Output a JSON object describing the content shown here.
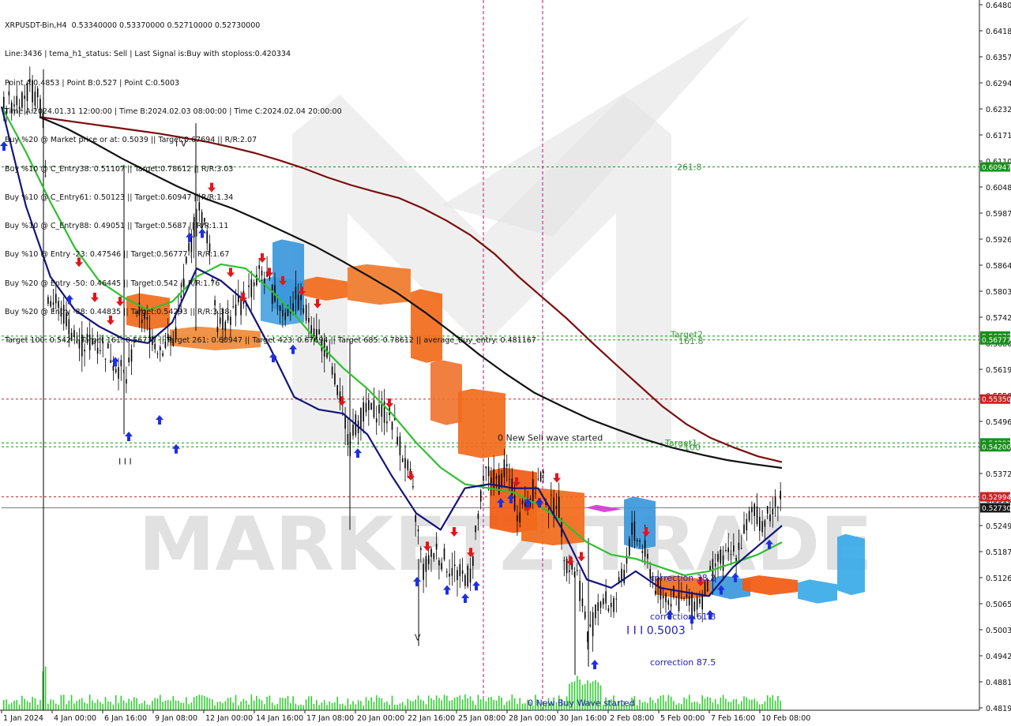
{
  "symbol_header": "XRPUSDT-Bin,H4  0.53340000 0.53370000 0.52710000 0.52730000",
  "info_lines": [
    "Line:3436 | tema_h1_status: Sell | Last Signal is:Buy with stoploss:0.420334",
    "Point A:0.4853 | Point B:0.527 | Point C:0.5003",
    "Time A:2024.01.31 12:00:00 | Time B:2024.02.03 08:00:00 | Time C:2024.02.04 20:00:00",
    "Buy %20 @ Market price or at: 0.5039 || Target:0.67694 || R/R:2.07",
    "Buy %10 @ C_Entry38: 0.51107 || Target:0.78612 || R/R:3.03",
    "Buy %10 @ C_Entry61: 0.50123 || Target:0.60947 || R/R:1.34",
    "Buy %10 @ C_Entry88: 0.49051 || Target:0.5687 || R/R:1.11",
    "Buy %10 @ Entry -23: 0.47546 || Target:0.56777 || R/R:1.67",
    "Buy %20 @ Entry -50: 0.46445 || Target:0.542 || R/R:1.76",
    "Buy %20 @ Entry -88: 0.44835 || Target:0.54293 || R/R:3.38",
    "Target 100: 0.542 || Target 161: 0.56777 || Target 261: 0.60947 || Target 423: 0.67694 || Target 685: 0.78612 || average_Buy_entry: 0.481167"
  ],
  "watermark": "MARKETZITRADE",
  "chart_data": {
    "type": "candlestick",
    "symbol": "XRPUSDT-Bin",
    "timeframe": "H4",
    "last_price": 0.5273,
    "ylim": [
      0.4785,
      0.6497
    ],
    "y_ticks": [
      "0.64803",
      "0.64189",
      "0.63575",
      "0.62943",
      "0.62329",
      "0.61715",
      "0.61102",
      "0.60489",
      "0.59875",
      "0.59261",
      "0.58647",
      "0.58034",
      "0.57420",
      "0.56807",
      "0.56193",
      "0.55580",
      "0.54966",
      "0.54352",
      "0.53720",
      "0.53106",
      "0.52493",
      "0.51879",
      "0.51265",
      "0.50652",
      "0.50038",
      "0.49425",
      "0.48811",
      "0.48197"
    ],
    "x_tick_labels": [
      "1 Jan 2024",
      "4 Jan 00:00",
      "6 Jan 16:00",
      "9 Jan 08:00",
      "12 Jan 00:00",
      "14 Jan 16:00",
      "17 Jan 08:00",
      "20 Jan 00:00",
      "22 Jan 16:00",
      "25 Jan 08:00",
      "28 Jan 00:00",
      "30 Jan 16:00",
      "2 Feb 08:00",
      "5 Feb 00:00",
      "7 Feb 16:00",
      "10 Feb 08:00"
    ],
    "price_tags": [
      {
        "value": 0.60947,
        "label": "0.60947",
        "color": "#1b8f1b"
      },
      {
        "value": 0.5687,
        "label": "0.56870",
        "color": "#1b8f1b"
      },
      {
        "value": 0.56777,
        "label": "0.56777",
        "color": "#1b8f1b"
      },
      {
        "value": 0.5535,
        "label": "0.55350",
        "color": "#cc2222"
      },
      {
        "value": 0.54293,
        "label": "0.54293",
        "color": "#1b8f1b"
      },
      {
        "value": 0.542,
        "label": "0.54200",
        "color": "#1b8f1b"
      },
      {
        "value": 0.52994,
        "label": "0.52994",
        "color": "#cc2222"
      },
      {
        "value": 0.5273,
        "label": "0.52730",
        "color": "#1a1a1a"
      }
    ],
    "annotations": [
      {
        "text": "261.8",
        "x": "7 Feb",
        "y": 0.6087,
        "color": "#3a9a3a"
      },
      {
        "text": "Target2",
        "x": "7 Feb",
        "y": 0.5684,
        "color": "#3a9a3a"
      },
      {
        "text": "161.8",
        "x": "7 Feb",
        "y": 0.5668,
        "color": "#3a9a3a"
      },
      {
        "text": "Target1",
        "x": "7 Feb",
        "y": 0.5422,
        "color": "#3a9a3a"
      },
      {
        "text": "100",
        "x": "7 Feb",
        "y": 0.5412,
        "color": "#3a9a3a"
      },
      {
        "text": "0 New Sell wave started",
        "x": "27 Jan",
        "y": 0.5435,
        "color": "#1a1a1a"
      },
      {
        "text": "0 New Buy Wave started",
        "x": "29 Jan",
        "y": 0.4795,
        "color": "#2222bb"
      },
      {
        "text": "correction 38.2",
        "x": "4 Feb",
        "y": 0.5097,
        "color": "#2222bb"
      },
      {
        "text": "correction 61.8",
        "x": "4 Feb",
        "y": 0.5004,
        "color": "#2222bb"
      },
      {
        "text": "I I I 0.5003",
        "x": "3 Feb",
        "y": 0.4969,
        "color": "#2222bb"
      },
      {
        "text": "correction 87.5",
        "x": "4 Feb",
        "y": 0.4893,
        "color": "#2222bb"
      },
      {
        "text": "I V",
        "x": "10 Jan",
        "y": 0.6144,
        "color": "#1a1a1a"
      },
      {
        "text": "I I I",
        "x": "7 Jan",
        "y": 0.5378,
        "color": "#1a1a1a"
      },
      {
        "text": "V",
        "x": "22 Jan",
        "y": 0.4953,
        "color": "#1a1a1a"
      }
    ],
    "series": [
      {
        "name": "",
        "color": "#7a0e0e",
        "points": [
          [
            0.6215,
            0.6207,
            0.6199,
            0.6191,
            0.6183,
            0.6175,
            0.6165,
            0.6155,
            0.6142,
            0.6128,
            0.6111,
            0.6092,
            0.607,
            0.6051,
            0.6035,
            0.602,
            0.5995,
            0.5965,
            0.593,
            0.5885,
            0.583,
            0.578,
            0.573,
            0.5675,
            0.5622,
            0.557,
            0.5518,
            0.5475,
            0.5442,
            0.5418,
            0.5397,
            0.5383
          ]
        ]
      },
      {
        "name": "",
        "color": "#111111",
        "points": [
          [
            0.6215,
            0.6187,
            0.6152,
            0.6115,
            0.6081,
            0.6048,
            0.6019,
            0.5995,
            0.5966,
            0.5935,
            0.5904,
            0.5868,
            0.583,
            0.5791,
            0.5745,
            0.5695,
            0.5642,
            0.5594,
            0.555,
            0.5518,
            0.5487,
            0.5462,
            0.5438,
            0.5418,
            0.5402,
            0.5388,
            0.5378,
            0.5369
          ]
        ]
      },
      {
        "name": "",
        "color": "#2fc02f",
        "points": [
          [
            0.624,
            0.613,
            0.601,
            0.59,
            0.582,
            0.578,
            0.575,
            0.577,
            0.583,
            0.586,
            0.585,
            0.58,
            0.574,
            0.567,
            0.561,
            0.556,
            0.55,
            0.543,
            0.537,
            0.533,
            0.532,
            0.531,
            0.528,
            0.524,
            0.519,
            0.516,
            0.515,
            0.513,
            0.511,
            0.512,
            0.514,
            0.516,
            0.519
          ]
        ]
      },
      {
        "name": "",
        "color": "#14147a",
        "points": [
          [
            0.624,
            0.6,
            0.583,
            0.575,
            0.571,
            0.568,
            0.567,
            0.572,
            0.585,
            0.582,
            0.577,
            0.566,
            0.554,
            0.551,
            0.55,
            0.545,
            0.535,
            0.526,
            0.522,
            0.532,
            0.533,
            0.532,
            0.532,
            0.522,
            0.51,
            0.508,
            0.512,
            0.508,
            0.507,
            0.506,
            0.513,
            0.518,
            0.523
          ]
        ]
      }
    ]
  }
}
